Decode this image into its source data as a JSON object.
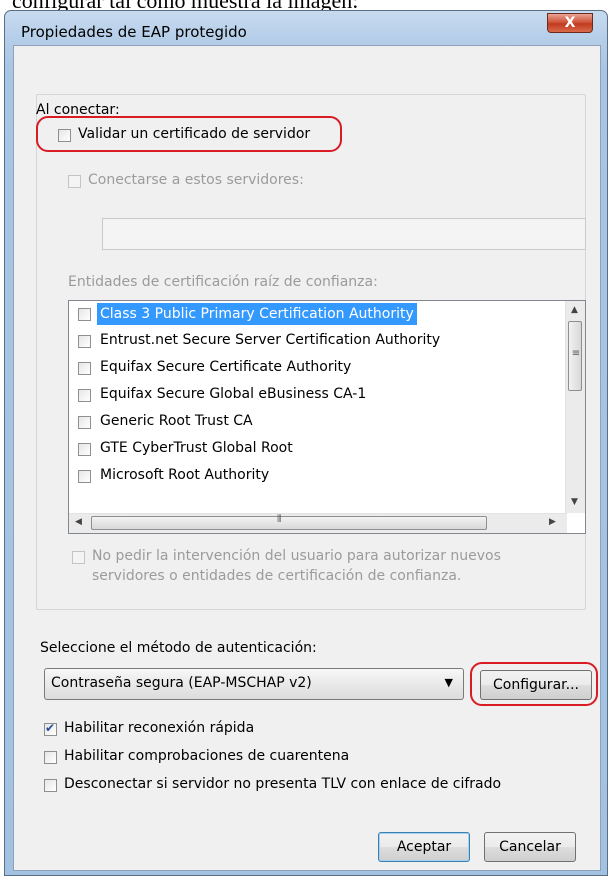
{
  "caption": "configurar tal como muestra la imagen:",
  "window": {
    "title": "Propiedades de EAP protegido",
    "close_glyph": "X"
  },
  "connect": {
    "heading": "Al conectar:",
    "validate_cert": {
      "label": "Validar un certificado de servidor",
      "checked": false
    },
    "connect_servers": {
      "label": "Conectarse a estos servidores:",
      "checked": false
    },
    "servers_value": "",
    "root_ca_label": "Entidades de certificación raíz de confianza:",
    "ca_list": [
      {
        "label": "Class 3 Public Primary Certification Authority",
        "checked": false,
        "selected": true
      },
      {
        "label": "Entrust.net Secure Server Certification Authority",
        "checked": false
      },
      {
        "label": "Equifax Secure Certificate Authority",
        "checked": false
      },
      {
        "label": "Equifax Secure Global eBusiness CA-1",
        "checked": false
      },
      {
        "label": "Generic Root Trust CA",
        "checked": false
      },
      {
        "label": "GTE CyberTrust Global Root",
        "checked": false
      },
      {
        "label": "Microsoft Root Authority",
        "checked": false
      }
    ],
    "no_prompt": {
      "line1": "No pedir la intervención del usuario para autorizar nuevos",
      "line2": "servidores o entidades de certificación de confianza.",
      "checked": false
    }
  },
  "auth": {
    "label": "Seleccione el método de autenticación:",
    "method": "Contraseña segura (EAP-MSCHAP v2)",
    "configure": "Configurar..."
  },
  "options": [
    {
      "label": "Habilitar reconexión rápida",
      "checked": true
    },
    {
      "label": "Habilitar comprobaciones de cuarentena",
      "checked": false
    },
    {
      "label": "Desconectar si servidor no presenta TLV con enlace de cifrado",
      "checked": false
    }
  ],
  "buttons": {
    "ok": "Aceptar",
    "cancel": "Cancelar"
  },
  "colors": {
    "highlight": "#d81b24",
    "selection": "#3399ff"
  }
}
